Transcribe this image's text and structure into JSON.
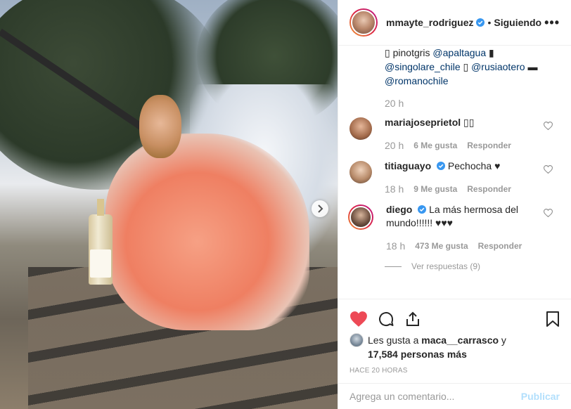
{
  "header": {
    "username": "mmayte_rodriguez",
    "separator": "•",
    "follow_status": "Siguiendo",
    "more_label": "•••"
  },
  "caption_tail": {
    "line1_prefix": "▯ pinotgris ",
    "line1_mention": "@apaltagua",
    "line1_suffix": " ▮",
    "line2_mention1": "@singolare_chile",
    "line2_mid": " ▯ ",
    "line2_mention2": "@rusiaotero",
    "line2_suffix": " ▬",
    "line3_mention": "@romanochile",
    "time": "20 h"
  },
  "comments": [
    {
      "user": "mariajoseprietol",
      "text": "▯▯",
      "time": "20 h",
      "likes": "6 Me gusta",
      "reply": "Responder",
      "verified": false
    },
    {
      "user": "titiaguayo",
      "text": "Pechocha ♥",
      "time": "18 h",
      "likes": "9 Me gusta",
      "reply": "Responder",
      "verified": true
    },
    {
      "user": "diego",
      "text": "La más hermosa del mundo!!!!!! ♥♥♥",
      "time": "18 h",
      "likes": "473 Me gusta",
      "reply": "Responder",
      "verified": true
    }
  ],
  "view_replies": "Ver respuestas (9)",
  "likes_line": {
    "prefix": "Les gusta a ",
    "user": "maca__carrasco",
    "middle": " y ",
    "count": "17,584 personas más"
  },
  "post_time": "HACE 20 HORAS",
  "add_comment": {
    "placeholder": "Agrega un comentario...",
    "publish": "Publicar"
  },
  "colors": {
    "like_red": "#ed4956",
    "verified_blue": "#3897f0",
    "publish_disabled": "#b2dffc",
    "mention": "#003569"
  }
}
